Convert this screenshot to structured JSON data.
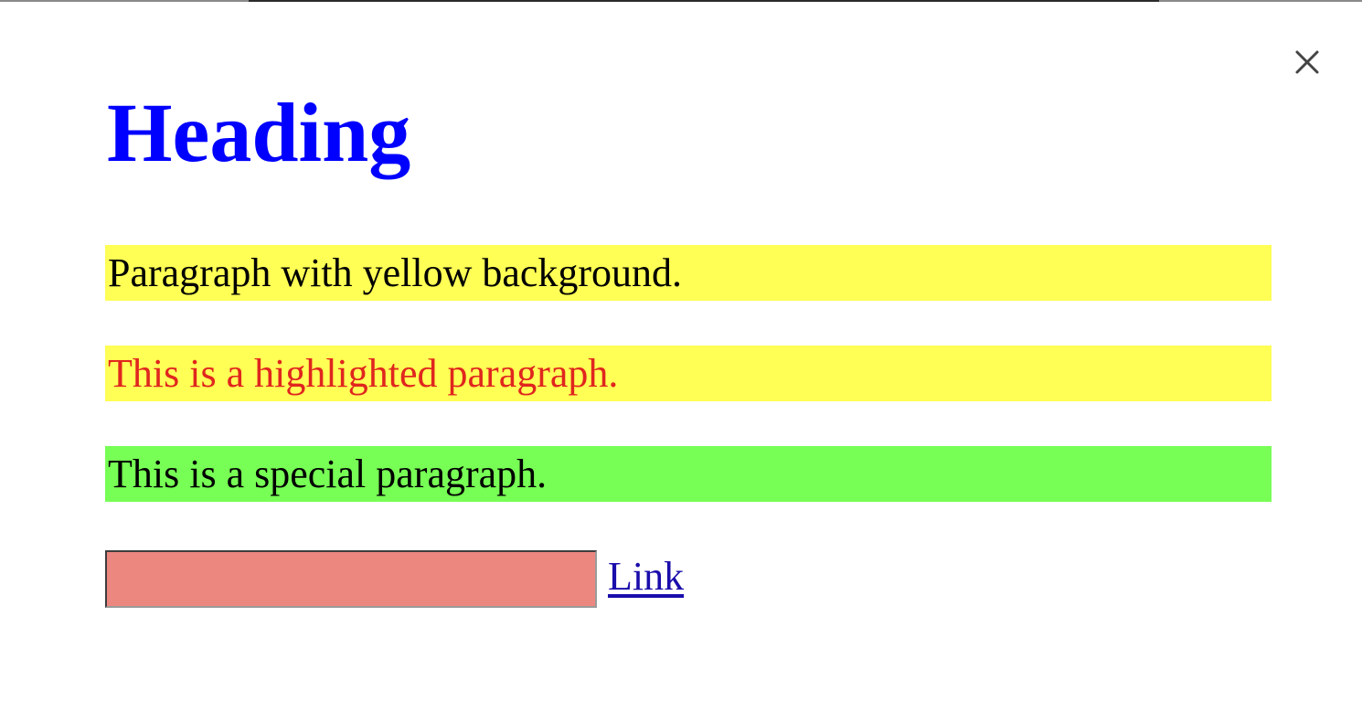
{
  "dialog": {
    "close_icon": "close-icon"
  },
  "content": {
    "heading": "Heading",
    "paragraphs": [
      "Paragraph with yellow background.",
      "This is a highlighted paragraph.",
      "This is a special paragraph."
    ],
    "input": {
      "value": "",
      "placeholder": ""
    },
    "link_text": "Link"
  },
  "colors": {
    "heading": "#0000ff",
    "yellow_background": "#ffff55",
    "highlight_text": "#e0261e",
    "special_background": "#77ff55",
    "input_background": "#ec8780",
    "link": "#1a0dab",
    "close_icon": "#444444",
    "text": "#000000"
  }
}
